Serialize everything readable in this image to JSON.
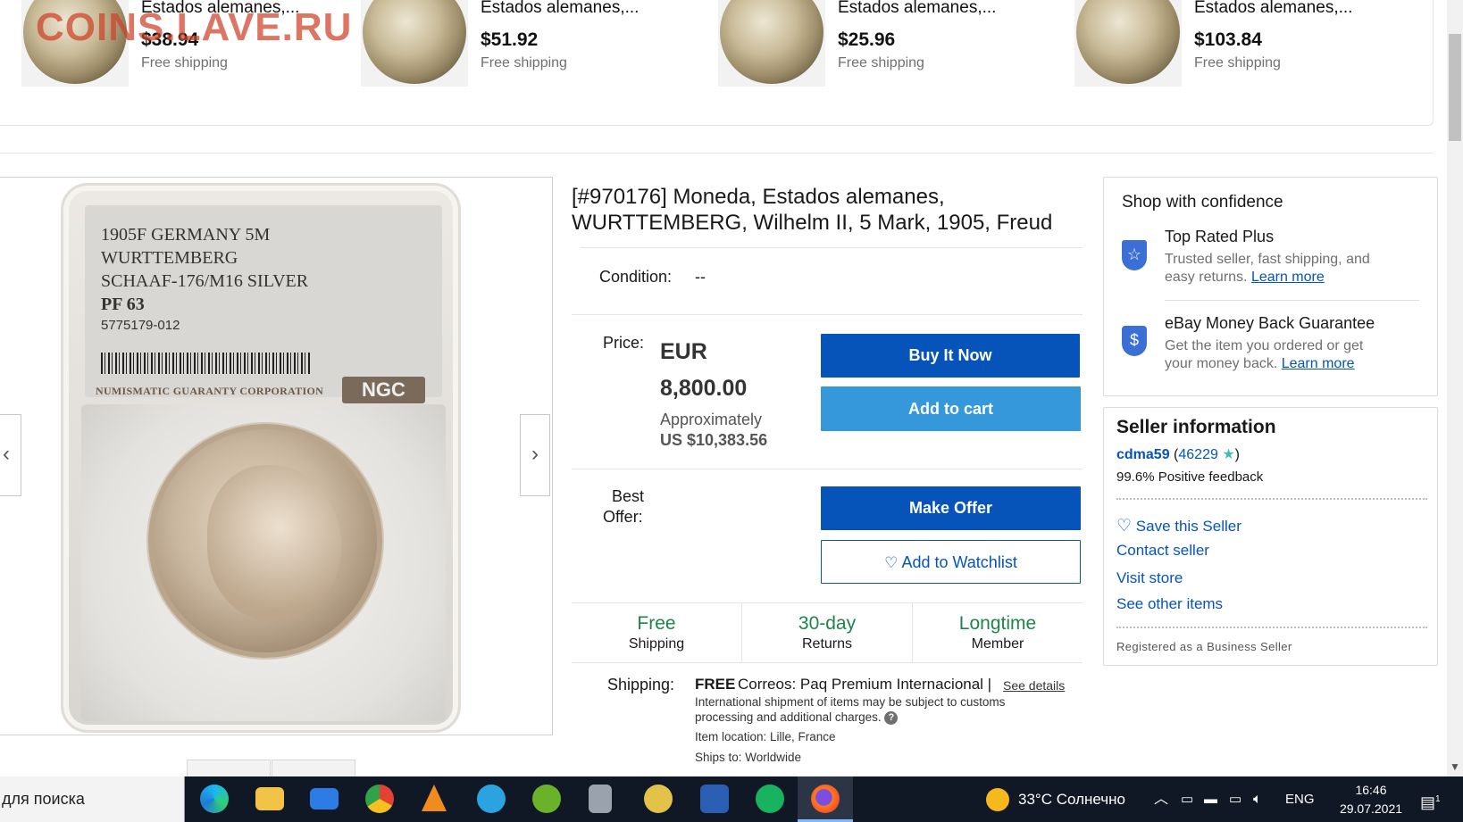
{
  "watermark": "COINS.LAVE.RU",
  "related_items": [
    {
      "title": "Estados alemanes,...",
      "price": "$38.94",
      "shipping": "Free shipping"
    },
    {
      "title": "Estados alemanes,...",
      "price": "$51.92",
      "shipping": "Free shipping"
    },
    {
      "title": "Estados alemanes,...",
      "price": "$25.96",
      "shipping": "Free shipping"
    },
    {
      "title": "Estados alemanes,...",
      "price": "$103.84",
      "shipping": "Free shipping"
    }
  ],
  "slab": {
    "line1": "1905F GERMANY 5M",
    "line2": "WURTTEMBERG",
    "line3": "SCHAAF-176/M16 SILVER",
    "grade": "PF 63",
    "cert": "5775179-012",
    "corp": "NUMISMATIC GUARANTY CORPORATION",
    "logo": "NGC"
  },
  "gallery": {
    "prev_arrow": "‹",
    "next_arrow": "›"
  },
  "item": {
    "title": "[#970176] Moneda, Estados alemanes, WURTTEMBERG, Wilhelm II, 5 Mark, 1905, Freud",
    "condition_label": "Condition:",
    "condition_value": "--",
    "price_label": "Price:",
    "price_currency": "EUR",
    "price_amount": "8,800.00",
    "approx_label": "Approximately",
    "approx_value": "US $10,383.56",
    "best_offer_label_1": "Best",
    "best_offer_label_2": "Offer:"
  },
  "buttons": {
    "buy_now": "Buy It Now",
    "add_to_cart": "Add to cart",
    "make_offer": "Make Offer",
    "add_to_watchlist": "Add to Watchlist"
  },
  "badges": [
    {
      "top": "Free",
      "bottom": "Shipping"
    },
    {
      "top": "30-day",
      "bottom": "Returns"
    },
    {
      "top": "Longtime",
      "bottom": "Member"
    }
  ],
  "shipping": {
    "label": "Shipping:",
    "free": "FREE",
    "service": "Correos: Paq Premium Internacional |",
    "see_details": "See details",
    "note_1": "International shipment of items may be subject to customs",
    "note_2": "processing and additional charges.",
    "location": "Item location:  Lille, France",
    "ships_to": "Ships to:  Worldwide"
  },
  "confidence": {
    "heading": "Shop with confidence",
    "items": [
      {
        "title": "Top Rated Plus",
        "text_1": "Trusted seller, fast shipping, and",
        "text_2": "easy returns.",
        "link": "Learn more"
      },
      {
        "title": "eBay Money Back Guarantee",
        "text_1": "Get the item you ordered or get",
        "text_2": "your money back.",
        "link": "Learn more"
      }
    ]
  },
  "seller": {
    "heading": "Seller information",
    "name": "cdma59",
    "feedback_score": "46229",
    "paren_open": "(",
    "paren_close": ")",
    "positive": "99.6% Positive feedback",
    "save": "Save this Seller",
    "contact": "Contact seller",
    "visit": "Visit store",
    "other": "See other items",
    "registered": "Registered as a Business Seller"
  },
  "taskbar": {
    "search_text": "для поиска",
    "weather": "33°C  Солнечно",
    "language": "ENG",
    "time": "16:46",
    "date": "29.07.2021",
    "notification_count": "1"
  },
  "colors": {
    "primary_blue": "#0654ba",
    "cart_blue": "#3498db",
    "green": "#1e8449",
    "taskbar": "#101826"
  }
}
